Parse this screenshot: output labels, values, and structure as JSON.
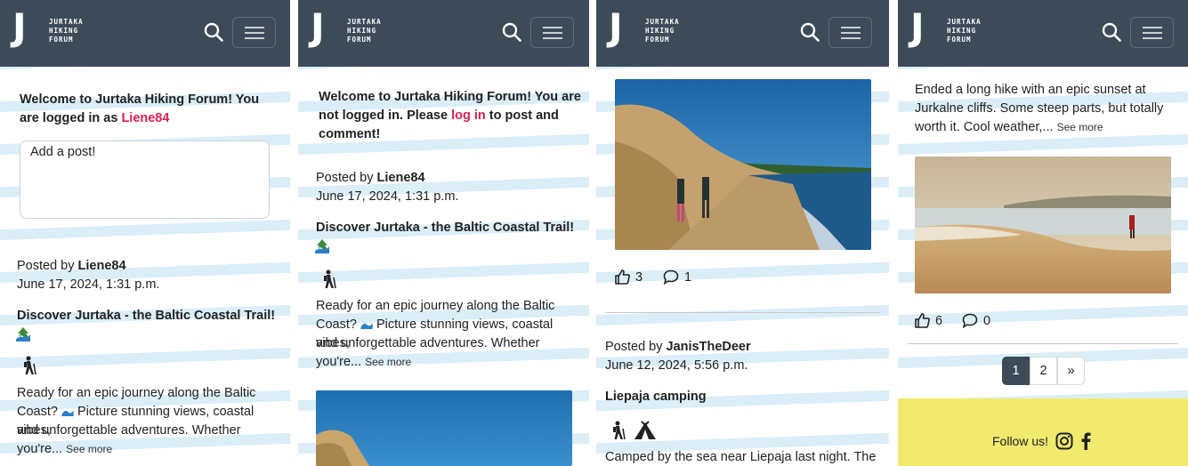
{
  "brand": {
    "letter": "J",
    "line1": "JURTAKA",
    "line2": "HIKING",
    "line3": "FORUM"
  },
  "icons": {
    "search": "search-icon",
    "menu": "hamburger-icon",
    "like": "thumbs-up-icon",
    "comment": "speech-bubble-icon",
    "hiker": "hiker-icon",
    "tent": "tent-icon",
    "tree": "evergreen-tree-emoji",
    "wave": "wave-emoji",
    "instagram": "instagram-icon",
    "facebook": "facebook-icon"
  },
  "colors": {
    "navbar": "#3d4b59",
    "accent": "#d6204f",
    "footer": "#f0eb6e"
  },
  "screen1": {
    "welcome_pre": "Welcome to Jurtaka Hiking Forum! You are logged in as",
    "username": "Liene84",
    "composer_placeholder": "Add a post!",
    "post": {
      "posted_by_label": "Posted by",
      "author": "Liene84",
      "date": "June 17, 2024, 1:31 p.m.",
      "title": "Discover Jurtaka - the Baltic Coastal Trail!",
      "body_l1": "Ready for an epic journey along the Baltic",
      "body_l2a": "Coast?",
      "body_l2b": "Picture stunning views, coastal vibes,",
      "body_l3": "and unforgettable adventures. Whether",
      "body_l4": "you're...",
      "see_more": "See more"
    }
  },
  "screen2": {
    "welcome_l1": "Welcome to Jurtaka Hiking Forum! You are",
    "welcome_l2": "not logged in. Please",
    "login_link": "log in",
    "welcome_l2b": "to post and",
    "welcome_l3": "comment!",
    "post": {
      "posted_by_label": "Posted by",
      "author": "Liene84",
      "date": "June 17, 2024, 1:31 p.m.",
      "title": "Discover Jurtaka - the Baltic Coastal Trail!",
      "body_l1": "Ready for an epic journey along the Baltic",
      "body_l2a": "Coast?",
      "body_l2b": "Picture stunning views, coastal vibes,",
      "body_l3": "and unforgettable adventures. Whether",
      "body_l4": "you're...",
      "see_more": "See more"
    }
  },
  "screen3": {
    "likes": "3",
    "comments": "1",
    "post": {
      "posted_by_label": "Posted by",
      "author": "JanisTheDeer",
      "date": "June 12, 2024, 5:56 p.m.",
      "title": "Liepaja camping",
      "body_l1": "Camped by the sea near Liepaja last night. The"
    }
  },
  "screen4": {
    "post_l1": "Ended a long hike with an epic sunset at",
    "post_l2": "Jurkalne cliffs. Some steep parts, but totally",
    "post_l3": "worth it. Cool weather,...",
    "see_more": "See more",
    "likes": "6",
    "comments": "0",
    "pagination": {
      "page1": "1",
      "page2": "2",
      "next": "»"
    },
    "footer_text": "Follow us!"
  }
}
